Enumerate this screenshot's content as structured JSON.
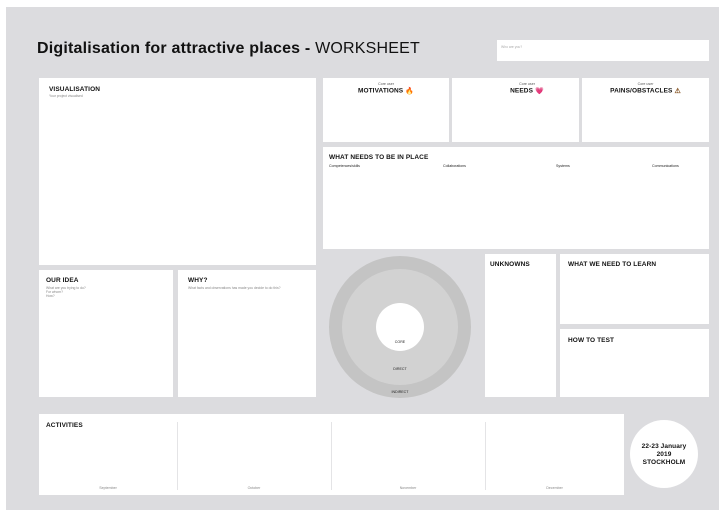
{
  "header": {
    "title_bold": "Digitalisation for attractive places - ",
    "title_light": "WORKSHEET",
    "who_placeholder": "Who are you?"
  },
  "visualisation": {
    "title": "VISUALISATION",
    "subtitle": "Your project visualised"
  },
  "core_user": [
    {
      "caption": "Core user",
      "label": "MOTIVATIONS",
      "icon": "fire-icon",
      "icon_glyph": "🔥"
    },
    {
      "caption": "Core user",
      "label": "NEEDS",
      "icon": "heart-icon",
      "icon_glyph": "💗"
    },
    {
      "caption": "Core user",
      "label": "PAINS/OBSTACLES",
      "icon": "warning-icon",
      "icon_glyph": "⚠"
    }
  ],
  "needs_in_place": {
    "title": "WHAT NEEDS TO BE IN PLACE",
    "columns": [
      "Competences/skills",
      "Collaborations",
      "Systems",
      "Communications"
    ]
  },
  "our_idea": {
    "title": "OUR IDEA",
    "subtitle": "What are you trying to do?\nFor whom?\nHow?"
  },
  "why": {
    "title": "WHY?",
    "subtitle": "What facts and observations has made you decide to do this?"
  },
  "rings": {
    "core": "CORE",
    "direct": "DIRECT",
    "indirect": "INDIRECT"
  },
  "unknowns": {
    "title": "UNKNOWNS"
  },
  "learn": {
    "title": "WHAT WE NEED TO LEARN"
  },
  "test": {
    "title": "HOW TO TEST"
  },
  "activities": {
    "title": "ACTIVITIES",
    "months": [
      "September",
      "October",
      "November",
      "December"
    ]
  },
  "event": {
    "dates": "22-23 January",
    "year": "2019",
    "city": "STOCKHOLM"
  },
  "colors": {
    "background": "#dcdcdf",
    "panel": "#ffffff",
    "ring_outer": "#c4c4c4",
    "ring_mid": "#d2d2d2"
  }
}
